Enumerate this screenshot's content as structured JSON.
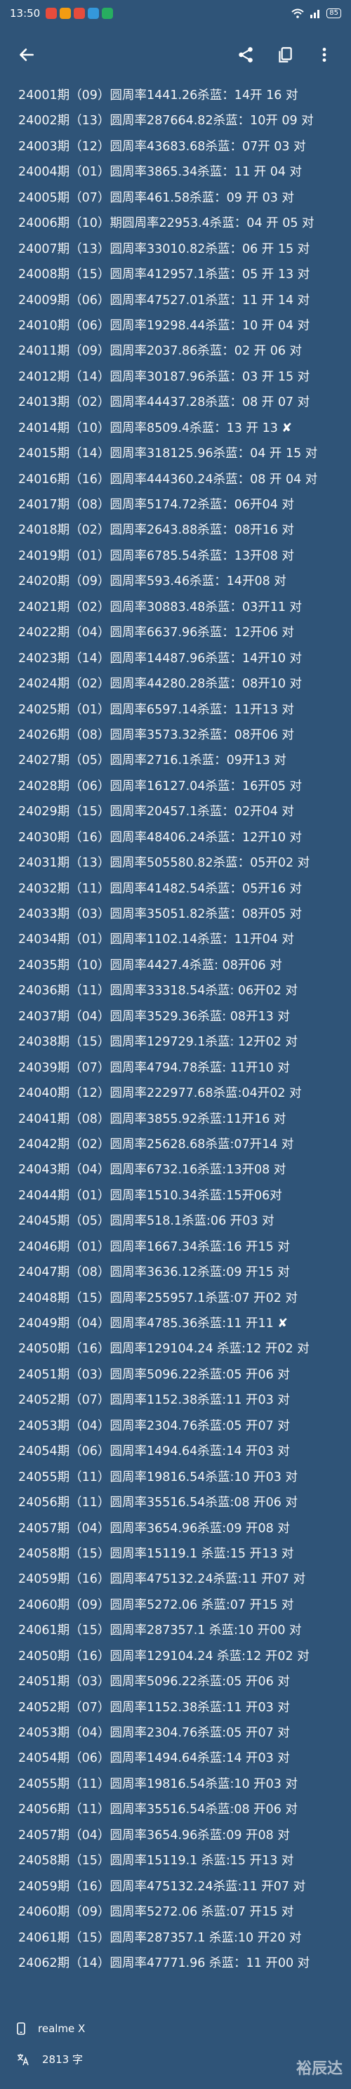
{
  "status": {
    "time": "13:50",
    "notif_colors": [
      "#e74c3c",
      "#f39c12",
      "#e74c3c",
      "#3498db",
      "#27ae60"
    ],
    "battery": "85"
  },
  "lines": [
    "24001期（09）圆周率1441.26杀蓝：14开 16 对",
    "24002期（13）圆周率287664.82杀蓝：10开 09 对",
    "24003期（12）圆周率43683.68杀蓝：07开 03 对",
    "24004期（01）圆周率3865.34杀蓝：11 开 04 对",
    "24005期（07）圆周率461.58杀蓝：09 开 03 对",
    "24006期（10）期圆周率22953.4杀蓝：04 开 05 对",
    "24007期（13）圆周率33010.82杀蓝：06 开 15 对",
    "24008期（15）圆周率412957.1杀蓝：05 开 13 对",
    "24009期（06）圆周率47527.01杀蓝：11 开 14 对",
    "24010期（06）圆周率19298.44杀蓝：10 开 04 对",
    "24011期（09）圆周率2037.86杀蓝：02 开 06 对",
    "24012期（14）圆周率30187.96杀蓝：03 开 15 对",
    "24013期（02）圆周率44437.28杀蓝：08 开 07 对",
    "24014期（10）圆周率8509.4杀蓝：13 开 13",
    "24015期（14）圆周率318125.96杀蓝：04 开 15 对",
    "24016期（16）圆周率444360.24杀蓝：08 开 04 对",
    "24017期（08）圆周率5174.72杀蓝：06开04 对",
    "24018期（02）圆周率2643.88杀蓝：08开16 对",
    "24019期（01）圆周率6785.54杀蓝：13开08 对",
    "24020期（09）圆周率593.46杀蓝：14开08 对",
    "24021期（02）圆周率30883.48杀蓝：03开11 对",
    "24022期（04）圆周率6637.96杀蓝：12开06 对",
    "24023期（14）圆周率14487.96杀蓝：14开10 对",
    "24024期（02）圆周率44280.28杀蓝：08开10 对",
    "24025期（01）圆周率6597.14杀蓝：11开13  对",
    "24026期（08）圆周率3573.32杀蓝：08开06  对",
    "24027期（05）圆周率2716.1杀蓝：09开13 对",
    "24028期（06）圆周率16127.04杀蓝：16开05 对",
    "24029期（15）圆周率20457.1杀蓝：02开04 对",
    "24030期（16）圆周率48406.24杀蓝：12开10 对",
    "24031期（13）圆周率505580.82杀蓝：05开02 对",
    "24032期（11）圆周率41482.54杀蓝：05开16 对",
    "24033期（03）圆周率35051.82杀蓝：08开05 对",
    "24034期（01）圆周率1102.14杀蓝：11开04 对",
    "24035期（10）圆周率4427.4杀蓝: 08开06 对",
    "24036期（11）圆周率33318.54杀蓝: 06开02 对",
    "24037期（04）圆周率3529.36杀蓝: 08开13 对",
    "24038期（15）圆周率129729.1杀蓝: 12开02 对",
    "24039期（07）圆周率4794.78杀蓝: 11开10 对",
    "24040期（12）圆周率222977.68杀蓝:04开02 对",
    "24041期（08）圆周率3855.92杀蓝:11开16 对",
    "24042期（02）圆周率25628.68杀蓝:07开14 对",
    "24043期（04）圆周率6732.16杀蓝:13开08 对",
    "24044期（01）圆周率1510.34杀蓝:15开06对",
    "24045期（05）圆周率518.1杀蓝:06 开03 对",
    "24046期（01）圆周率1667.34杀蓝:16 开15 对",
    "24047期（08）圆周率3636.12杀蓝:09 开15 对",
    "24048期（15）圆周率255957.1杀蓝:07 开02 对",
    "24049期（04）圆周率4785.36杀蓝:11  开11",
    "24050期（16）圆周率129104.24 杀蓝:12 开02 对",
    "24051期（03）圆周率5096.22杀蓝:05  开06 对",
    "24052期（07）圆周率1152.38杀蓝:11  开03 对",
    "24053期（04）圆周率2304.76杀蓝:05  开07 对",
    "24054期（06）圆周率1494.64杀蓝:14  开03 对",
    "24055期（11）圆周率19816.54杀蓝:10  开03 对",
    "24056期（11）圆周率35516.54杀蓝:08  开06 对",
    "24057期（04）圆周率3654.96杀蓝:09  开08 对",
    "24058期（15）圆周率15119.1 杀蓝:15  开13 对",
    "24059期（16）圆周率475132.24杀蓝:11  开07 对",
    "24060期（09）圆周率5272.06 杀蓝:07  开15 对",
    "24061期（15）圆周率287357.1 杀蓝:10  开00 对",
    "24050期（16）圆周率129104.24 杀蓝:12 开02 对",
    "24051期（03）圆周率5096.22杀蓝:05  开06 对",
    "24052期（07）圆周率1152.38杀蓝:11  开03 对",
    "24053期（04）圆周率2304.76杀蓝:05  开07 对",
    "24054期（06）圆周率1494.64杀蓝:14  开03 对",
    "24055期（11）圆周率19816.54杀蓝:10  开03 对",
    "24056期（11）圆周率35516.54杀蓝:08  开06 对",
    "24057期（04）圆周率3654.96杀蓝:09  开08 对",
    "24058期（15）圆周率15119.1 杀蓝:15  开13 对",
    "24059期（16）圆周率475132.24杀蓝:11  开07 对",
    "24060期（09）圆周率5272.06 杀蓝:07  开15 对",
    "24061期（15）圆周率287357.1 杀蓝:10  开20 对",
    "24062期（14）圆周率47771.96  杀蓝：11 开00 对"
  ],
  "x_marks": [
    "✘",
    "✘"
  ],
  "device": "realme X",
  "word_count": "2813 字",
  "watermark": "裕辰达"
}
